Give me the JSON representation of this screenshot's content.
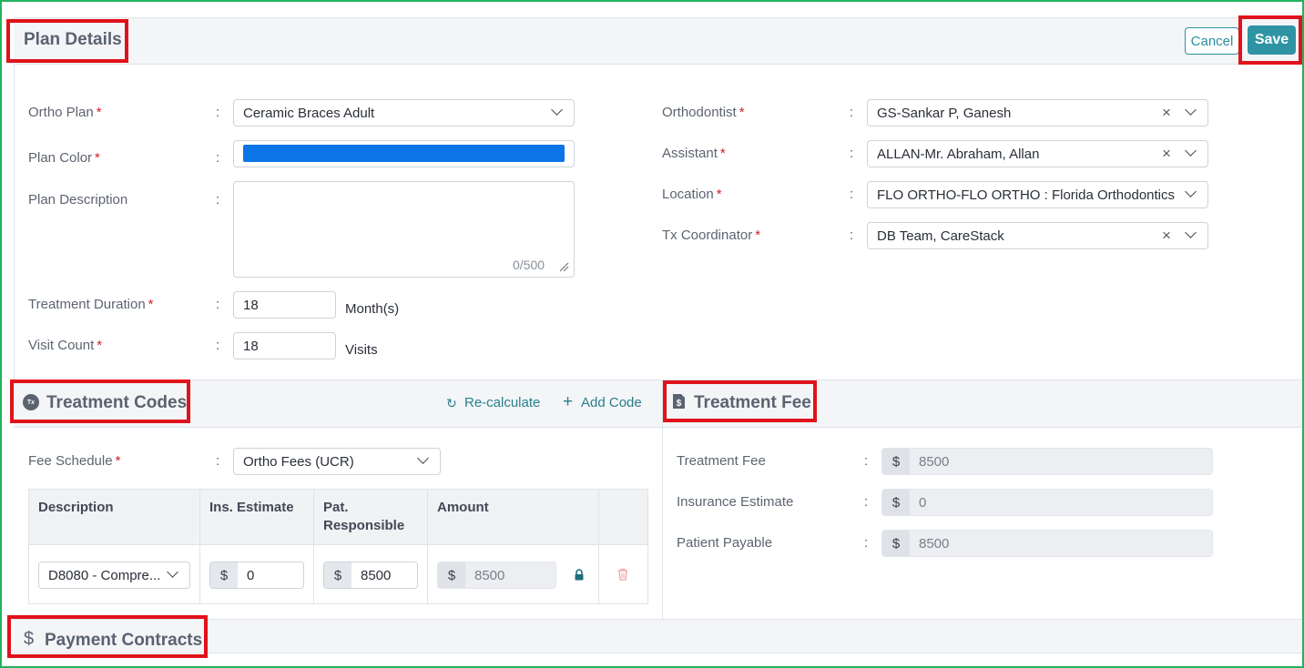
{
  "plan_details": {
    "title": "Plan Details",
    "cancel_label": "Cancel",
    "save_label": "Save",
    "ortho_plan": {
      "label": "Ortho Plan",
      "value": "Ceramic Braces Adult"
    },
    "plan_color": {
      "label": "Plan Color",
      "value": "#0b74e6"
    },
    "plan_description": {
      "label": "Plan Description",
      "counter": "0/500"
    },
    "treatment_duration": {
      "label": "Treatment Duration",
      "value": "18",
      "unit": "Month(s)"
    },
    "visit_count": {
      "label": "Visit Count",
      "value": "18",
      "unit": "Visits"
    },
    "orthodontist": {
      "label": "Orthodontist",
      "value": "GS-Sankar P, Ganesh"
    },
    "assistant": {
      "label": "Assistant",
      "value": "ALLAN-Mr. Abraham, Allan"
    },
    "location": {
      "label": "Location",
      "value": "FLO ORTHO-FLO ORTHO : Florida Orthodontics"
    },
    "tx_coordinator": {
      "label": "Tx Coordinator",
      "value": "DB Team, CareStack"
    },
    "required_mark": "*",
    "colon": ":"
  },
  "treatment_codes": {
    "title": "Treatment Codes",
    "tx_badge": "Tx",
    "recalculate_label": "Re-calculate",
    "add_code_label": "Add Code",
    "fee_schedule": {
      "label": "Fee Schedule",
      "value": "Ortho Fees (UCR)"
    },
    "columns": [
      "Description",
      "Ins. Estimate",
      "Pat. Responsible",
      "Amount"
    ],
    "rows": [
      {
        "description": "D8080 - Compre...",
        "ins_estimate": "0",
        "pat_responsible": "8500",
        "amount": "8500"
      }
    ],
    "currency": "$"
  },
  "treatment_fee": {
    "title": "Treatment Fee",
    "treatment_fee": {
      "label": "Treatment Fee",
      "value": "8500"
    },
    "insurance_estimate": {
      "label": "Insurance Estimate",
      "value": "0"
    },
    "patient_payable": {
      "label": "Patient Payable",
      "value": "8500"
    }
  },
  "payment_contracts": {
    "title": "Payment Contracts",
    "icon": "$"
  },
  "colors": {
    "accent": "#2e94a3",
    "highlight_box": "#e0121b",
    "frame": "#22b35e"
  }
}
